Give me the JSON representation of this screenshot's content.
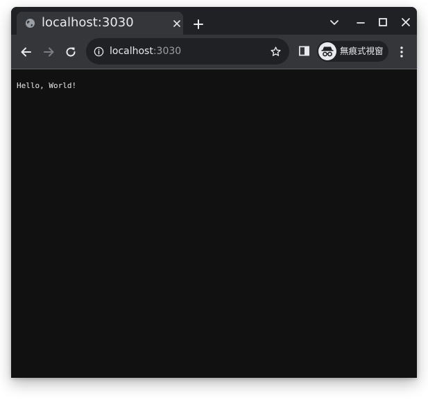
{
  "tab": {
    "title": "localhost:3030",
    "favicon": "globe-icon",
    "close_icon": "close-icon"
  },
  "tabstrip": {
    "new_tab_icon": "plus-icon",
    "search_tabs_icon": "chevron-down-icon",
    "minimize_icon": "minimize-icon",
    "maximize_icon": "maximize-icon",
    "close_window_icon": "close-icon"
  },
  "toolbar": {
    "back_icon": "arrow-left-icon",
    "forward_icon": "arrow-right-icon",
    "reload_icon": "reload-icon",
    "address": {
      "host": "localhost",
      "port": ":3030",
      "info_icon": "info-icon",
      "bookmark_icon": "star-icon"
    },
    "side_panel_icon": "side-panel-icon",
    "profile": {
      "label": "無痕式視窗",
      "icon": "incognito-icon"
    },
    "menu_icon": "more-vertical-icon"
  },
  "page": {
    "text": "Hello, World!",
    "background": "#111111"
  },
  "colors": {
    "tabstrip_bg": "#202124",
    "toolbar_bg": "#35363a",
    "text_primary": "#e8eaed",
    "text_secondary": "#9aa0a6"
  }
}
